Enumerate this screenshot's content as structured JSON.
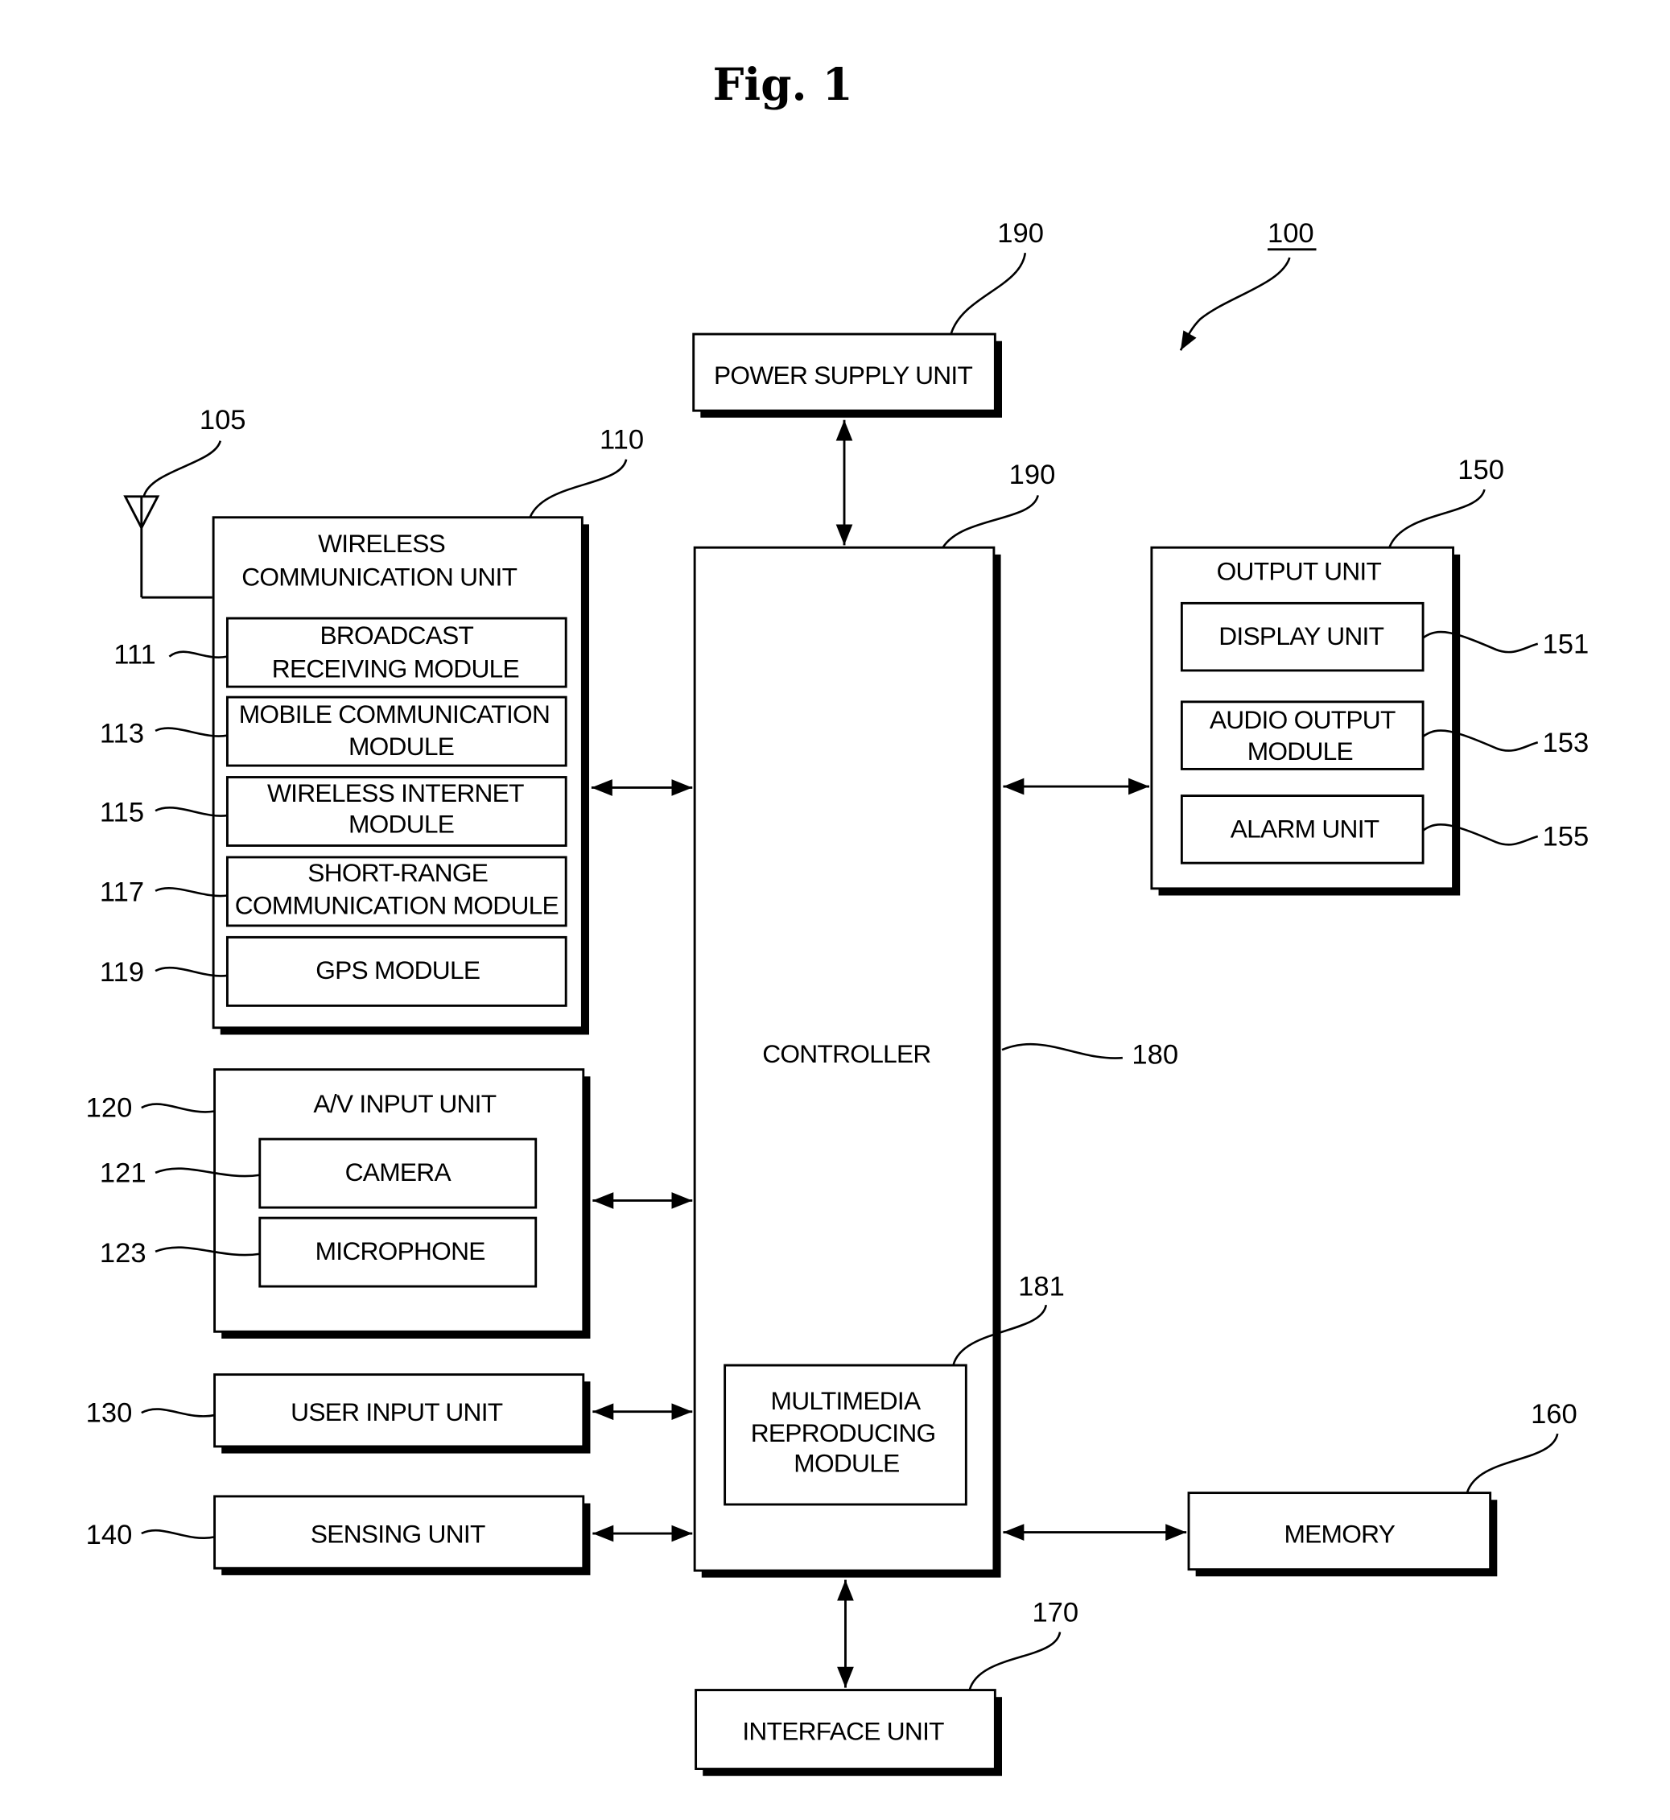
{
  "figure": {
    "title": "Fig. 1",
    "device_ref": "100"
  },
  "blocks": {
    "power_supply": {
      "label": "POWER SUPPLY UNIT",
      "ref": "190"
    },
    "controller": {
      "label": "CONTROLLER",
      "ref_top": "190",
      "ref_side": "180"
    },
    "multimedia": {
      "lines": [
        "MULTIMEDIA",
        "REPRODUCING",
        "MODULE"
      ],
      "ref": "181"
    },
    "antenna": {
      "ref": "105"
    },
    "wireless": {
      "lines": [
        "WIRELESS",
        "COMMUNICATION UNIT"
      ],
      "ref": "110",
      "modules": [
        {
          "ref": "111",
          "lines": [
            "BROADCAST",
            "RECEIVING MODULE"
          ]
        },
        {
          "ref": "113",
          "lines": [
            "MOBILE COMMUNICATION",
            "MODULE"
          ]
        },
        {
          "ref": "115",
          "lines": [
            "WIRELESS INTERNET",
            "MODULE"
          ]
        },
        {
          "ref": "117",
          "lines": [
            "SHORT-RANGE",
            "COMMUNICATION MODULE"
          ]
        },
        {
          "ref": "119",
          "lines": [
            "GPS MODULE"
          ]
        }
      ]
    },
    "av_input": {
      "label": "A/V INPUT UNIT",
      "ref": "120",
      "modules": [
        {
          "ref": "121",
          "label": "CAMERA"
        },
        {
          "ref": "123",
          "label": "MICROPHONE"
        }
      ]
    },
    "user_input": {
      "label": "USER INPUT UNIT",
      "ref": "130"
    },
    "sensing": {
      "label": "SENSING UNIT",
      "ref": "140"
    },
    "output": {
      "label": "OUTPUT UNIT",
      "ref": "150",
      "modules": [
        {
          "ref": "151",
          "lines": [
            "DISPLAY UNIT"
          ]
        },
        {
          "ref": "153",
          "lines": [
            "AUDIO OUTPUT",
            "MODULE"
          ]
        },
        {
          "ref": "155",
          "lines": [
            "ALARM UNIT"
          ]
        }
      ]
    },
    "memory": {
      "label": "MEMORY",
      "ref": "160"
    },
    "interface": {
      "label": "INTERFACE UNIT",
      "ref": "170"
    }
  }
}
